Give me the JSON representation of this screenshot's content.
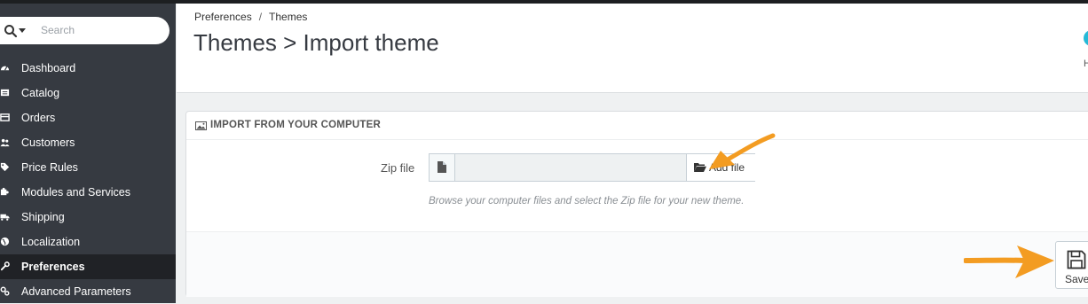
{
  "colors": {
    "sidebar_bg": "#363a41",
    "sidebar_active_bg": "#202226",
    "accent": "#25b9d7",
    "annotation_arrow": "#f39c22"
  },
  "search": {
    "placeholder": "Search"
  },
  "sidebar": {
    "items": [
      {
        "label": "Dashboard",
        "icon": "dashboard-icon"
      },
      {
        "label": "Catalog",
        "icon": "catalog-icon"
      },
      {
        "label": "Orders",
        "icon": "orders-icon"
      },
      {
        "label": "Customers",
        "icon": "customers-icon"
      },
      {
        "label": "Price Rules",
        "icon": "price-rules-icon"
      },
      {
        "label": "Modules and Services",
        "icon": "puzzle-icon"
      },
      {
        "label": "Shipping",
        "icon": "truck-icon"
      },
      {
        "label": "Localization",
        "icon": "globe-icon"
      },
      {
        "label": "Preferences",
        "icon": "wrench-icon",
        "active": true
      },
      {
        "label": "Advanced Parameters",
        "icon": "cogs-icon"
      }
    ]
  },
  "header": {
    "breadcrumb": [
      "Preferences",
      "Themes"
    ],
    "breadcrumb_sep": "/",
    "title": "Themes > Import theme",
    "help_label": "H"
  },
  "panel": {
    "title": "IMPORT FROM YOUR COMPUTER",
    "zip_label": "Zip file",
    "add_file_label": "Add file",
    "hint": "Browse your computer files and select the Zip file for your new theme.",
    "save_label": "Save"
  }
}
